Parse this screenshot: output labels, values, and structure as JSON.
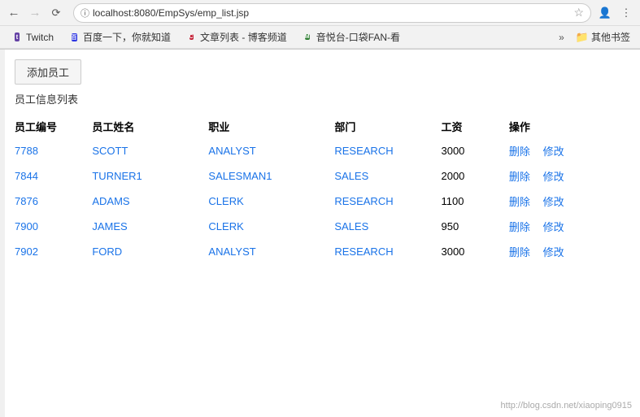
{
  "browser": {
    "url": "localhost:8080/EmpSys/emp_list.jsp",
    "back_disabled": false,
    "forward_disabled": true
  },
  "bookmarks": [
    {
      "id": "twitch",
      "label": "Twitch",
      "icon_type": "twitch"
    },
    {
      "id": "baidu",
      "label": "百度一下，你就知道",
      "icon_type": "baidu"
    },
    {
      "id": "csdn",
      "label": "文章列表 - 博客频道",
      "icon_type": "csdn"
    },
    {
      "id": "mdn",
      "label": "音悦台-口袋FAN-看",
      "icon_type": "mdn"
    }
  ],
  "bookmarks_more_label": "»",
  "bookmarks_other_label": "其他书签",
  "page": {
    "add_button_label": "添加员工",
    "title": "员工信息列表",
    "table": {
      "headers": [
        "员工编号",
        "员工姓名",
        "职业",
        "部门",
        "工资",
        "操作"
      ],
      "rows": [
        {
          "id": "7788",
          "name": "SCOTT",
          "job": "ANALYST",
          "dept": "RESEARCH",
          "sal": "3000"
        },
        {
          "id": "7844",
          "name": "TURNER1",
          "job": "SALESMAN1",
          "dept": "SALES",
          "sal": "2000"
        },
        {
          "id": "7876",
          "name": "ADAMS",
          "job": "CLERK",
          "dept": "RESEARCH",
          "sal": "1100"
        },
        {
          "id": "7900",
          "name": "JAMES",
          "job": "CLERK",
          "dept": "SALES",
          "sal": "950"
        },
        {
          "id": "7902",
          "name": "FORD",
          "job": "ANALYST",
          "dept": "RESEARCH",
          "sal": "3000"
        }
      ],
      "delete_label": "删除",
      "edit_label": "修改"
    }
  },
  "watermark": "http://blog.csdn.net/xiaoping0915"
}
